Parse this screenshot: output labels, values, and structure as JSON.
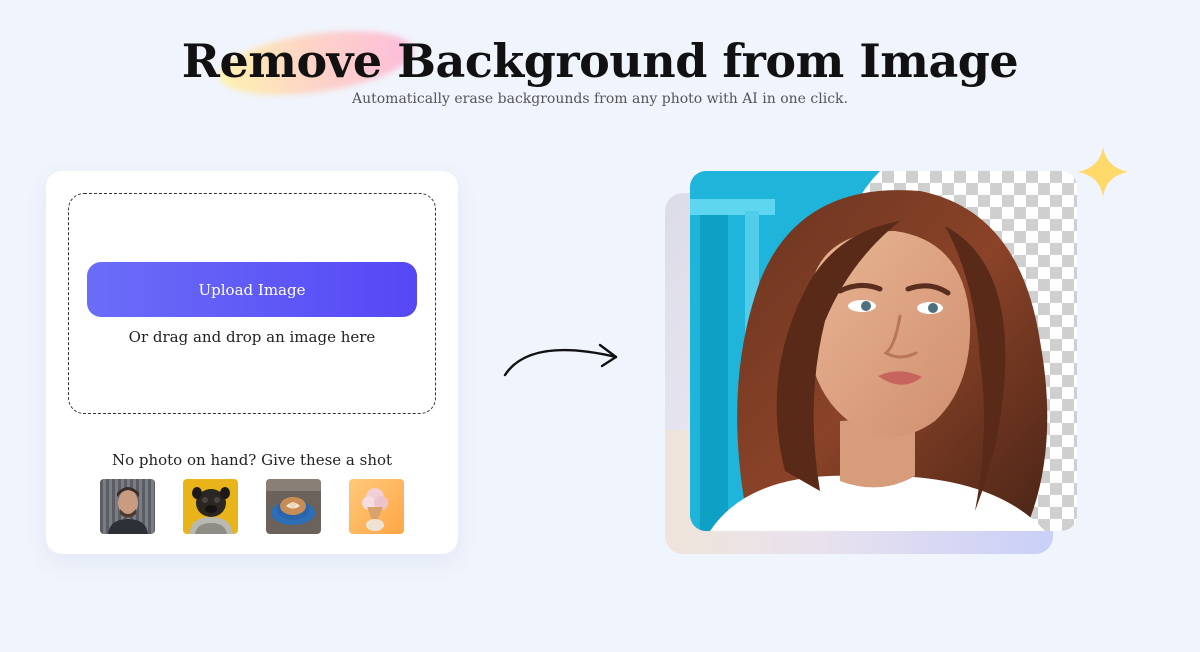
{
  "header": {
    "title": "Remove Background from Image",
    "subtitle": "Automatically erase backgrounds from any photo with AI in one click."
  },
  "upload": {
    "button_label": "Upload Image",
    "drag_text": "Or drag and drop an image here"
  },
  "samples": {
    "label": "No photo on hand? Give these a shot",
    "items": [
      {
        "name": "man-portrait"
      },
      {
        "name": "pug-dog"
      },
      {
        "name": "coffee-cup"
      },
      {
        "name": "ice-cream"
      }
    ]
  },
  "icons": {
    "arrow": "curved-arrow-right-icon",
    "sparkle": "sparkle-icon"
  },
  "colors": {
    "accent": "#5b50f6",
    "background": "#f0f4fc",
    "sparkle": "#ffd96a"
  }
}
